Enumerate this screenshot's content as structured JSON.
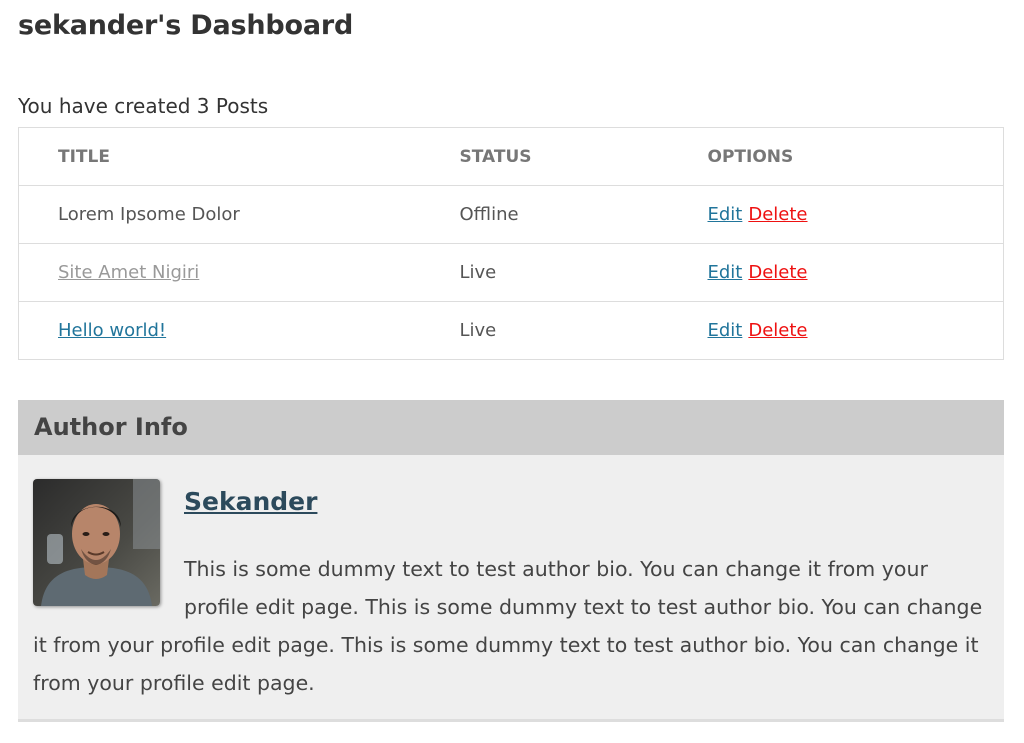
{
  "dashboard": {
    "title": "sekander's Dashboard",
    "posts_summary": "You have created 3 Posts"
  },
  "posts_table": {
    "headers": [
      "TITLE",
      "STATUS",
      "OPTIONS"
    ],
    "rows": [
      {
        "title": "Lorem Ipsome Dolor",
        "status": "Offline",
        "edit": "Edit",
        "delete": "Delete"
      },
      {
        "title": "Site Amet Nigiri",
        "status": "Live",
        "edit": "Edit",
        "delete": "Delete"
      },
      {
        "title": "Hello world!",
        "status": "Live",
        "edit": "Edit",
        "delete": "Delete"
      }
    ]
  },
  "author_info": {
    "heading": "Author Info",
    "name": "Sekander",
    "bio": "This is some dummy text to test author bio. You can change it from your profile edit page. This is some dummy text to test author bio. You can change it from your profile edit page. This is some dummy text to test author bio. You can change it from your profile edit page."
  },
  "colors": {
    "link": "#21759b",
    "delete": "#ee1111",
    "live": "#22bb22",
    "offline": "#aaaaaa",
    "author_header_bg": "#cccccc",
    "author_body_bg": "#efefef"
  }
}
